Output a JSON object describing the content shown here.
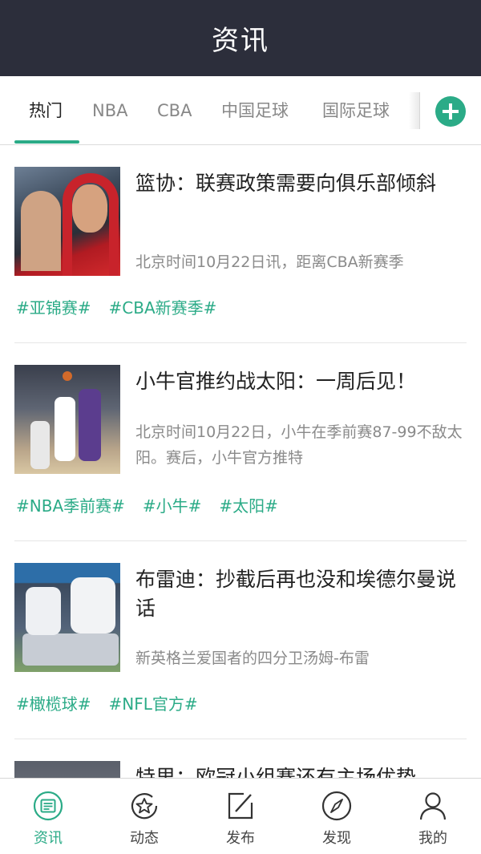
{
  "header": {
    "title": "资讯"
  },
  "tabs": [
    {
      "label": "热门",
      "active": true
    },
    {
      "label": "NBA",
      "active": false
    },
    {
      "label": "CBA",
      "active": false
    },
    {
      "label": "中国足球",
      "active": false
    },
    {
      "label": "国际足球",
      "active": false
    }
  ],
  "add_tab_icon": "plus-circle-icon",
  "articles": [
    {
      "title": "篮协：联赛政策需要向俱乐部倾斜",
      "summary": "北京时间10月22日讯，距离CBA新赛季",
      "tags": [
        "#亚锦赛#",
        "#CBA新赛季#"
      ]
    },
    {
      "title": "小牛官推约战太阳：一周后见！",
      "summary": "北京时间10月22日，小牛在季前赛87-99不敌太阳。赛后，小牛官方推特",
      "tags": [
        "#NBA季前赛#",
        "#小牛#",
        "#太阳#"
      ]
    },
    {
      "title": "布雷迪：抄截后再也没和埃德尔曼说话",
      "summary": "新英格兰爱国者的四分卫汤姆-布雷",
      "tags": [
        "#橄榄球#",
        "#NFL官方#"
      ]
    },
    {
      "title": "特里：欧冠小组赛还有主场优势",
      "summary": "",
      "tags": []
    }
  ],
  "bottom_nav": [
    {
      "label": "资讯",
      "icon": "news-icon",
      "active": true
    },
    {
      "label": "动态",
      "icon": "star-circle-icon",
      "active": false
    },
    {
      "label": "发布",
      "icon": "edit-icon",
      "active": false
    },
    {
      "label": "发现",
      "icon": "compass-icon",
      "active": false
    },
    {
      "label": "我的",
      "icon": "person-icon",
      "active": false
    }
  ],
  "colors": {
    "accent": "#2bab87",
    "header_bg": "#2c2e3b"
  }
}
